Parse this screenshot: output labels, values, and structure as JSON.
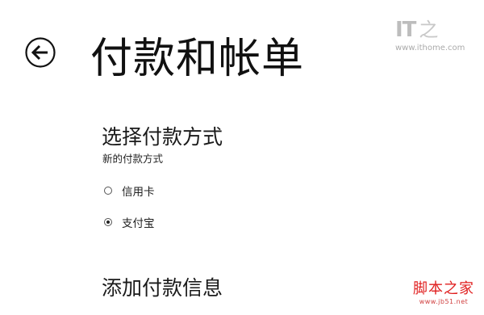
{
  "header": {
    "back_icon": "back-arrow-circle-icon",
    "title": "付款和帐单"
  },
  "choose_payment": {
    "title": "选择付款方式",
    "subtitle": "新的付款方式",
    "options": [
      {
        "label": "信用卡",
        "selected": false
      },
      {
        "label": "支付宝",
        "selected": true
      }
    ]
  },
  "add_payment": {
    "title": "添加付款信息"
  },
  "watermarks": {
    "ithome_mark": "IT",
    "ithome_glyph": "之",
    "ithome_url": "www.ithome.com",
    "jb51_name": "脚本之家",
    "jb51_url": "www.jb51.net"
  },
  "colors": {
    "background": "#ffffff",
    "text": "#111111",
    "jb51_red": "#e02020",
    "ithome_gray": "#bdbdbd"
  }
}
